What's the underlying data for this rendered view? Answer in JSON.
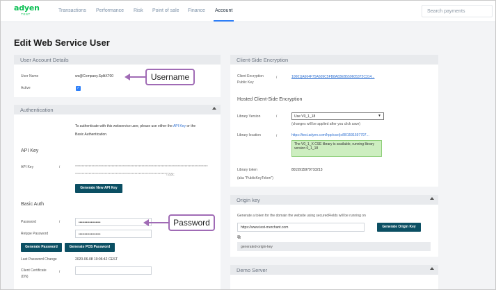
{
  "brand": {
    "name": "adyen",
    "env": "TEST",
    "color": "#0abf53"
  },
  "nav": {
    "items": [
      "Transactions",
      "Performance",
      "Risk",
      "Point of sale",
      "Finance",
      "Account"
    ],
    "active": "Account",
    "search_placeholder": "Search payments"
  },
  "page_title": "Edit Web Service User",
  "user_account": {
    "title": "User Account Details",
    "username_label": "User Name",
    "username_value": "ws@Company.SplitX700",
    "active_label": "Active",
    "active_checked": true
  },
  "authentication": {
    "title": "Authentication",
    "intro_prefix": "To authenticate with this webservice user, please use either the",
    "intro_link": "API Key",
    "intro_suffix": "or the",
    "intro_line2": "Basic Authentication.",
    "api_key_heading": "API Key",
    "api_key_label": "API Key",
    "api_key_line1": "**************************************************************************************************",
    "api_key_line2": "*******************************************************************T2j8c",
    "generate_api_key": "Generate New API Key",
    "basic_auth_heading": "Basic Auth",
    "password_label": "Password",
    "password_value": "••••••••••••••••••",
    "retype_label": "Retype Password",
    "retype_value": "••••••••••••••••••",
    "generate_password": "Generate Password",
    "generate_pos_password": "Generate POS Password",
    "last_change_label": "Last Password Change",
    "last_change_value": "2020-06-08 10:06:42 CEST",
    "client_cert_label": "Client Certificate",
    "client_cert_label2": "(DN)"
  },
  "cse": {
    "title": "Client-Side Encryption",
    "key_label": "Client Encryption",
    "key_label2": "Public Key",
    "key_value": "10001|A664F75A609C5FB8A83EB559605372C314...",
    "hosted_heading": "Hosted Client-Side Encryption",
    "library_version_label": "Library Version",
    "library_version_value": "Use V0_1_18",
    "library_version_note": "(changes will be applied after you click save)",
    "library_location_label": "Library location",
    "library_location_value": "https://test.adyen.com/hpp/cse/js/801591597797...",
    "library_notice": "The V0_1_X CSE library is available, running library version 0_1_18",
    "library_token_label": "Library token",
    "library_token_label2": "(aka \"PublicKeyToken\")",
    "library_token_value": "8015915979710213"
  },
  "origin_key": {
    "title": "Origin key",
    "description": "Generate a token for the domain the website using securedFields will be running on",
    "domain_value": "https://www.test-merchant.com",
    "generate_label": "Generate Origin Key",
    "generated_value": "generated-origin-key"
  },
  "demo_server": {
    "title": "Demo Server"
  },
  "callouts": {
    "username": "Username",
    "password": "Password"
  },
  "colors": {
    "accent": "#2d7ff9",
    "button": "#0b4f63",
    "callout": "#a06bb5"
  }
}
